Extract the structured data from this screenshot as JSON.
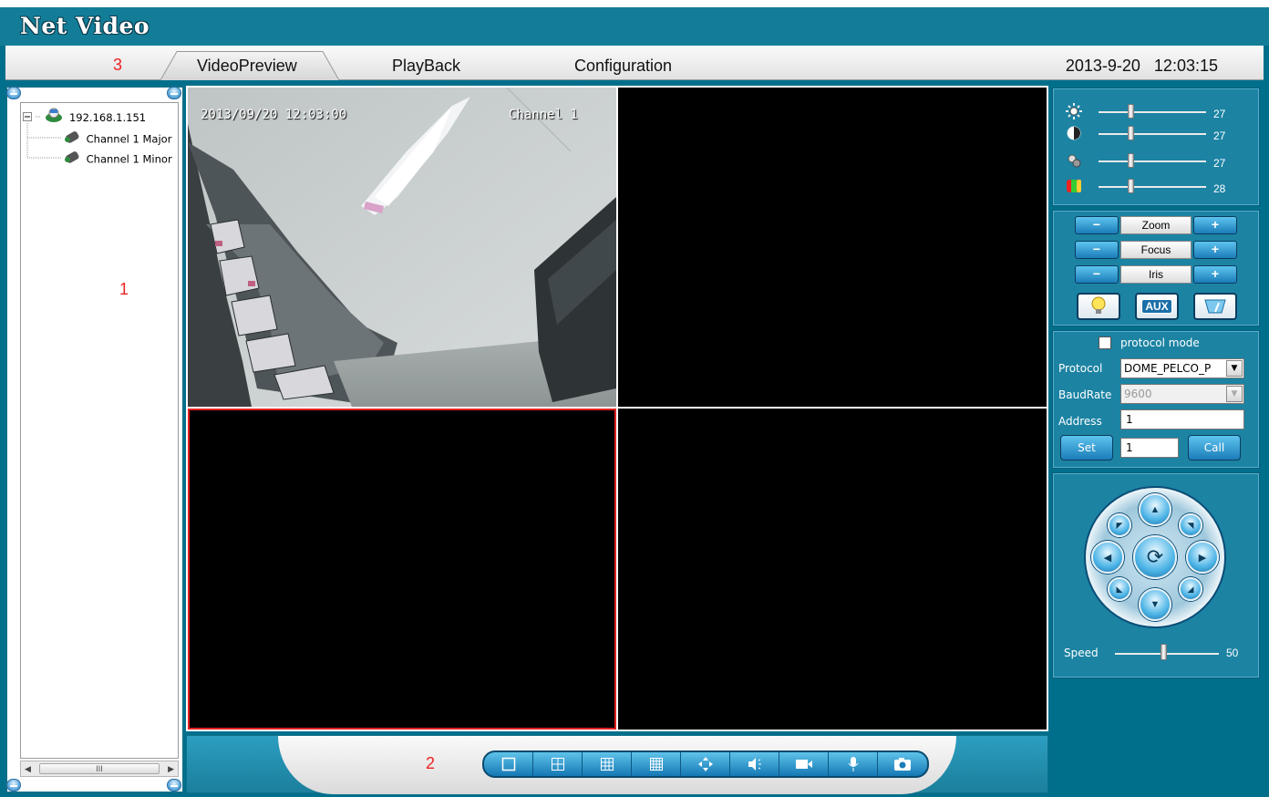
{
  "app": {
    "title": "Net Video"
  },
  "markers": {
    "m1": "1",
    "m2": "2",
    "m3": "3"
  },
  "tabs": [
    {
      "label": "VideoPreview",
      "active": true
    },
    {
      "label": "PlayBack",
      "active": false
    },
    {
      "label": "Configuration",
      "active": false
    }
  ],
  "datetime": "2013-9-20   12:03:15",
  "device_tree": {
    "root": {
      "label": "192.168.1.151",
      "expanded": true,
      "icon": "camera-network-icon"
    },
    "children": [
      {
        "label": "Channel 1 Major",
        "icon": "camera-icon"
      },
      {
        "label": "Channel 1 Minor",
        "icon": "camera-icon"
      }
    ],
    "scroll_thumb": "III"
  },
  "video": {
    "layout": "2x2",
    "selected_cell": 3,
    "cell1": {
      "osd_time": "2013/09/20 12:03:00",
      "osd_channel": "Channel 1",
      "has_feed": true
    }
  },
  "toolbar": {
    "buttons": [
      "split-1-icon",
      "split-4-icon",
      "split-9-icon",
      "split-16-icon",
      "fullscreen-icon",
      "audio-icon",
      "record-icon",
      "talk-icon",
      "snapshot-icon"
    ]
  },
  "image_adjust": [
    {
      "name": "brightness",
      "icon": "brightness-icon",
      "value": "27"
    },
    {
      "name": "contrast",
      "icon": "contrast-icon",
      "value": "27"
    },
    {
      "name": "saturation",
      "icon": "saturation-icon",
      "value": "27"
    },
    {
      "name": "hue",
      "icon": "hue-icon",
      "value": "28"
    }
  ],
  "lens": [
    {
      "label": "Zoom",
      "minus": "−",
      "plus": "+"
    },
    {
      "label": "Focus",
      "minus": "−",
      "plus": "+"
    },
    {
      "label": "Iris",
      "minus": "−",
      "plus": "+"
    }
  ],
  "lens_buttons": {
    "light": "light-icon",
    "aux": "AUX",
    "wiper": "wiper-icon"
  },
  "protocol": {
    "mode_label": "protocol mode",
    "mode_checked": false,
    "protocol_label": "Protocol",
    "protocol_value": "DOME_PELCO_P",
    "baud_label": "BaudRate",
    "baud_value": "9600",
    "address_label": "Address",
    "address_value": "1",
    "set_label": "Set",
    "preset_value": "1",
    "call_label": "Call"
  },
  "direction": {
    "speed_label": "Speed",
    "speed_value": "50",
    "speed_fraction": 0.5
  }
}
